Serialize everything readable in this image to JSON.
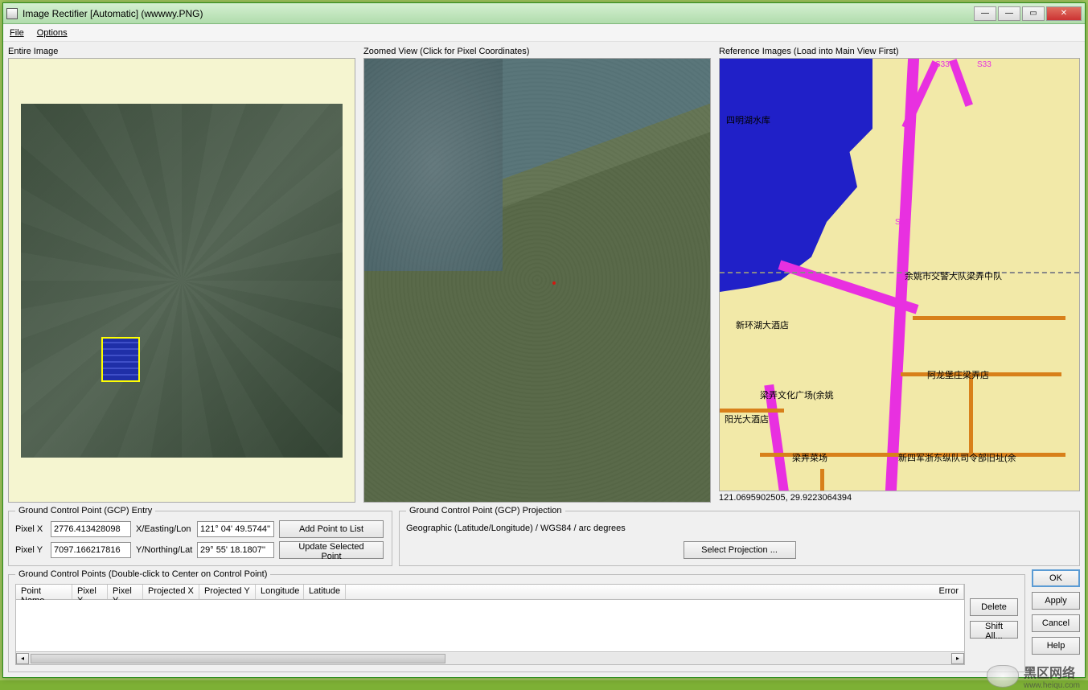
{
  "window": {
    "title": "Image Rectifier [Automatic] (wwwwy.PNG)"
  },
  "menu": {
    "file": "File",
    "options": "Options"
  },
  "panels": {
    "entire": "Entire Image",
    "zoomed": "Zoomed View (Click for Pixel Coordinates)",
    "reference": "Reference Images (Load into Main View First)"
  },
  "map": {
    "lake_label": "四明湖水库",
    "route1": "S33",
    "route2": "S33",
    "route3": "S33",
    "poi_traffic": "余姚市交警大队梁弄中队",
    "poi_hotel1": "新环湖大酒店",
    "poi_alongbao": "阿龙堡庄梁弄店",
    "poi_plaza": "梁弄文化广场(余姚",
    "poi_sunshine": "阳光大酒店",
    "poi_market": "梁弄菜场",
    "poi_army": "新四军浙东纵队司令部旧址(余",
    "coords": "121.0695902505, 29.9223064394"
  },
  "gcp_entry": {
    "legend": "Ground Control Point (GCP) Entry",
    "pixelX_label": "Pixel X",
    "pixelX_value": "2776.413428098",
    "easting_label": "X/Easting/Lon",
    "easting_value": "121° 04' 49.5744''",
    "pixelY_label": "Pixel Y",
    "pixelY_value": "7097.166217816",
    "northing_label": "Y/Northing/Lat",
    "northing_value": "29° 55' 18.1807''",
    "add_btn": "Add Point to List",
    "update_btn": "Update Selected Point"
  },
  "gcp_proj": {
    "legend": "Ground Control Point (GCP) Projection",
    "text": "Geographic (Latitude/Longitude) / WGS84 / arc degrees",
    "select_btn": "Select Projection ..."
  },
  "gcp_table": {
    "legend": "Ground Control Points (Double-click to Center on Control Point)",
    "cols": {
      "name": "Point Name",
      "px": "Pixel X",
      "py": "Pixel Y",
      "projx": "Projected X",
      "projy": "Projected Y",
      "lon": "Longitude",
      "lat": "Latitude",
      "err": "Error"
    }
  },
  "side_buttons": {
    "delete": "Delete",
    "shift": "Shift All..."
  },
  "right_buttons": {
    "ok": "OK",
    "apply": "Apply",
    "cancel": "Cancel",
    "help": "Help"
  },
  "watermark": {
    "text": "黑区网络",
    "sub": "www.heiqu.com"
  }
}
